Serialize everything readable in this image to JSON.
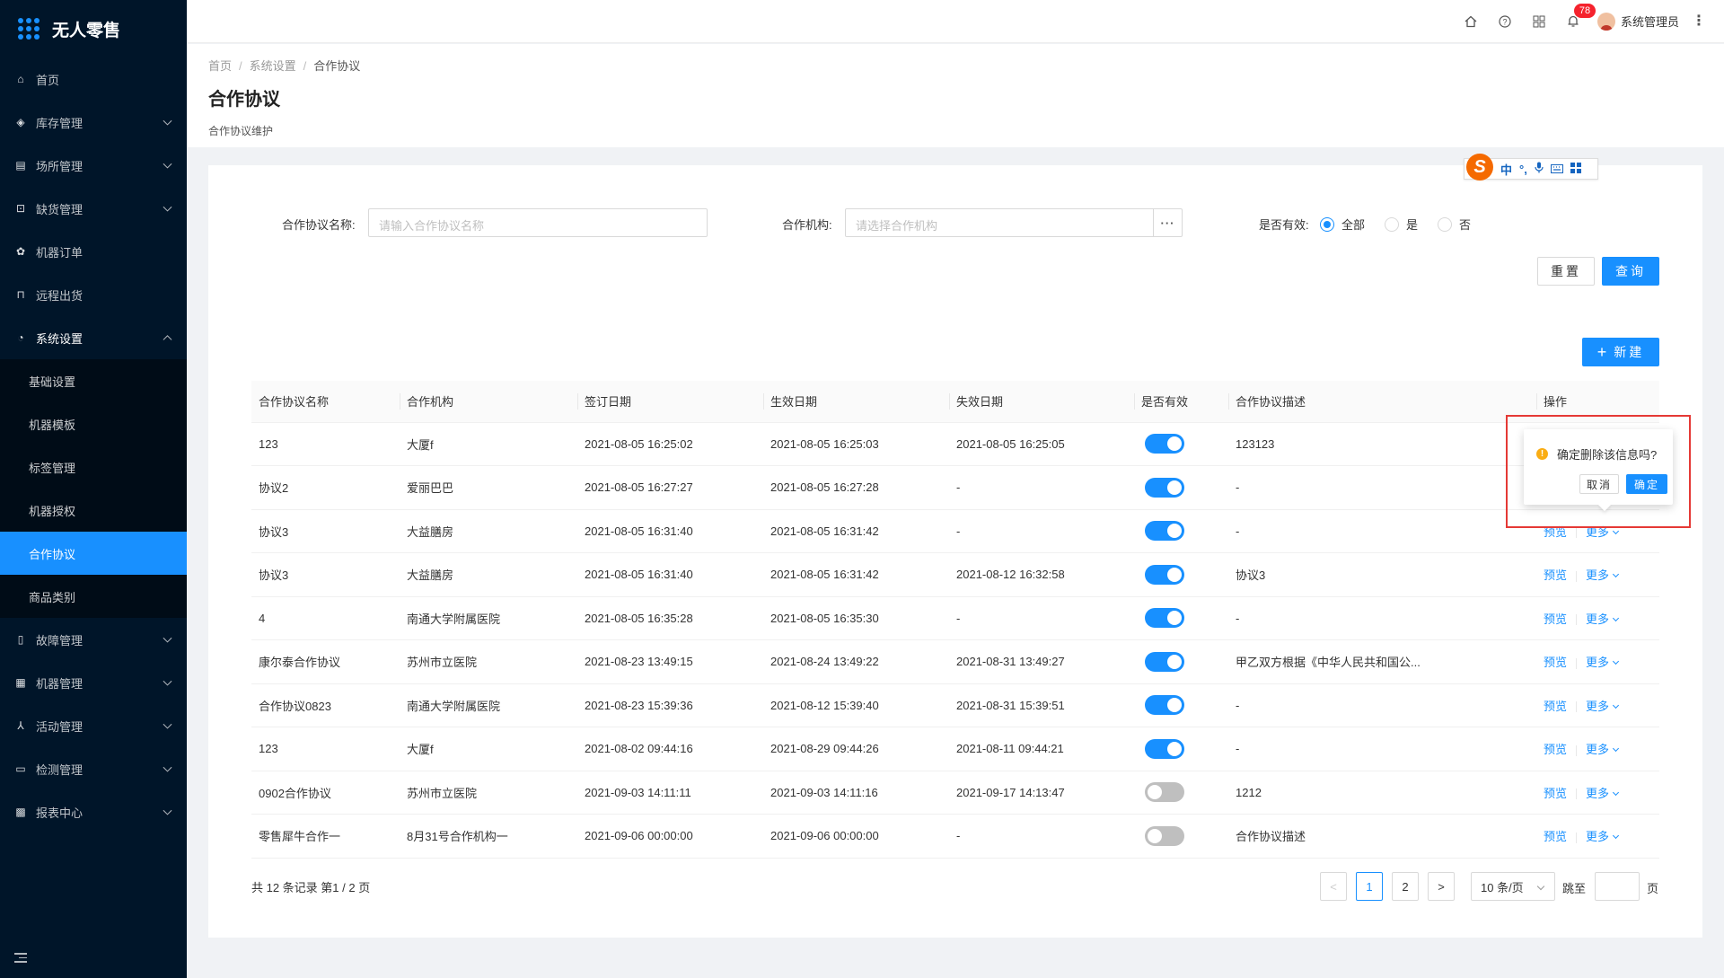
{
  "app": {
    "title": "无人零售"
  },
  "sidebar": {
    "items": [
      {
        "label": "首页",
        "icon": "home-icon",
        "glyph": "⌂",
        "has_children": false
      },
      {
        "label": "库存管理",
        "icon": "inventory-icon",
        "glyph": "◈",
        "has_children": true
      },
      {
        "label": "场所管理",
        "icon": "venue-icon",
        "glyph": "▤",
        "has_children": true
      },
      {
        "label": "缺货管理",
        "icon": "shortage-icon",
        "glyph": "⊡",
        "has_children": true
      },
      {
        "label": "机器订单",
        "icon": "order-icon",
        "glyph": "✿",
        "has_children": false
      },
      {
        "label": "远程出货",
        "icon": "remote-icon",
        "glyph": "⊓",
        "has_children": false
      },
      {
        "label": "系统设置",
        "icon": "settings-icon",
        "glyph": "◔",
        "has_children": true,
        "open": true,
        "children": [
          {
            "label": "基础设置"
          },
          {
            "label": "机器模板"
          },
          {
            "label": "标签管理"
          },
          {
            "label": "机器授权"
          },
          {
            "label": "合作协议",
            "active": true
          },
          {
            "label": "商品类别"
          }
        ]
      },
      {
        "label": "故障管理",
        "icon": "fault-icon",
        "glyph": "▯",
        "has_children": true
      },
      {
        "label": "机器管理",
        "icon": "machine-icon",
        "glyph": "▦",
        "has_children": true
      },
      {
        "label": "活动管理",
        "icon": "activity-icon",
        "glyph": "⅄",
        "has_children": true
      },
      {
        "label": "检测管理",
        "icon": "detect-icon",
        "glyph": "▭",
        "has_children": true
      },
      {
        "label": "报表中心",
        "icon": "report-icon",
        "glyph": "▩",
        "has_children": true
      }
    ]
  },
  "topbar": {
    "notification_count": "78",
    "user_name": "系统管理员"
  },
  "header": {
    "breadcrumb": [
      "首页",
      "系统设置",
      "合作协议"
    ],
    "title": "合作协议",
    "description": "合作协议维护"
  },
  "ime": {
    "items": [
      "中",
      "°,",
      "🎤",
      "⌨",
      "▦"
    ]
  },
  "search": {
    "name_label": "合作协议名称:",
    "name_placeholder": "请输入合作协议名称",
    "org_label": "合作机构:",
    "org_placeholder": "请选择合作机构",
    "org_addon": "···",
    "valid_label": "是否有效:",
    "valid_options": [
      "全部",
      "是",
      "否"
    ],
    "valid_selected": 0,
    "reset_label": "重置",
    "query_label": "查询"
  },
  "new_button": {
    "plus": "+",
    "label": "新建"
  },
  "table": {
    "columns": [
      "合作协议名称",
      "合作机构",
      "签订日期",
      "生效日期",
      "失效日期",
      "是否有效",
      "合作协议描述",
      "操作"
    ],
    "rows": [
      {
        "name": "123",
        "org": "大厦f",
        "sign": "2021-08-05 16:25:02",
        "effect": "2021-08-05 16:25:03",
        "expire": "2021-08-05 16:25:05",
        "valid": true,
        "desc": "123123",
        "show_ops": false
      },
      {
        "name": "协议2",
        "org": "爱丽巴巴",
        "sign": "2021-08-05 16:27:27",
        "effect": "2021-08-05 16:27:28",
        "expire": "-",
        "valid": true,
        "desc": "-",
        "show_ops": false
      },
      {
        "name": "协议3",
        "org": "大益膳房",
        "sign": "2021-08-05 16:31:40",
        "effect": "2021-08-05 16:31:42",
        "expire": "-",
        "valid": true,
        "desc": "-",
        "show_ops": true
      },
      {
        "name": "协议3",
        "org": "大益膳房",
        "sign": "2021-08-05 16:31:40",
        "effect": "2021-08-05 16:31:42",
        "expire": "2021-08-12 16:32:58",
        "valid": true,
        "desc": "协议3",
        "show_ops": true
      },
      {
        "name": "4",
        "org": "南通大学附属医院",
        "sign": "2021-08-05 16:35:28",
        "effect": "2021-08-05 16:35:30",
        "expire": "-",
        "valid": true,
        "desc": "-",
        "show_ops": true
      },
      {
        "name": "康尔泰合作协议",
        "org": "苏州市立医院",
        "sign": "2021-08-23 13:49:15",
        "effect": "2021-08-24 13:49:22",
        "expire": "2021-08-31 13:49:27",
        "valid": true,
        "desc": "甲乙双方根据《中华人民共和国公...",
        "show_ops": true
      },
      {
        "name": "合作协议0823",
        "org": "南通大学附属医院",
        "sign": "2021-08-23 15:39:36",
        "effect": "2021-08-12 15:39:40",
        "expire": "2021-08-31 15:39:51",
        "valid": true,
        "desc": "-",
        "show_ops": true
      },
      {
        "name": "123",
        "org": "大厦f",
        "sign": "2021-08-02 09:44:16",
        "effect": "2021-08-29 09:44:26",
        "expire": "2021-08-11 09:44:21",
        "valid": true,
        "desc": "-",
        "show_ops": true
      },
      {
        "name": "0902合作协议",
        "org": "苏州市立医院",
        "sign": "2021-09-03 14:11:11",
        "effect": "2021-09-03 14:11:16",
        "expire": "2021-09-17 14:13:47",
        "valid": false,
        "desc": "1212",
        "show_ops": true
      },
      {
        "name": "零售犀牛合作一",
        "org": "8月31号合作机构一",
        "sign": "2021-09-06 00:00:00",
        "effect": "2021-09-06 00:00:00",
        "expire": "-",
        "valid": false,
        "desc": "合作协议描述",
        "show_ops": true
      }
    ],
    "ops": {
      "preview": "预览",
      "more": "更多"
    }
  },
  "popconfirm": {
    "icon": "!",
    "message": "确定删除该信息吗?",
    "cancel": "取消",
    "ok": "确定"
  },
  "pagination": {
    "total_text": "共 12 条记录 第1 / 2 页",
    "prev": "<",
    "next": ">",
    "pages": [
      "1",
      "2"
    ],
    "current": "1",
    "page_size": "10 条/页",
    "jump_label": "跳至",
    "page_suffix": "页"
  },
  "colors": {
    "primary": "#1890ff",
    "sidebar_bg": "#001529",
    "highlight_border": "#e53935",
    "warning": "#faad14"
  }
}
